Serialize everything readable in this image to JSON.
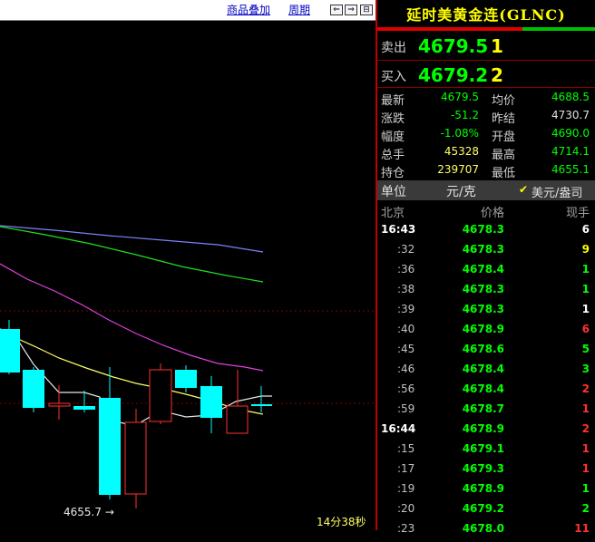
{
  "toolbar": {
    "overlay_label": "商品叠加",
    "period_label": "周期",
    "btn_prev": "⇐",
    "btn_next": "⇒",
    "btn_toggle": "⊟"
  },
  "chart": {
    "low_label": "4655.7",
    "timer": "14分38秒",
    "colors": {
      "up": "#ff3030",
      "down": "#00ffff",
      "ma_white": "#e8e8e8",
      "ma_yellow": "#ffff66",
      "ma_magenta": "#e040e0",
      "ma_green": "#20e020",
      "ma_blue": "#8080ff",
      "grid": "#800000"
    }
  },
  "quote": {
    "title": "延时美黄金连(GLNC)",
    "sell_label": "卖出",
    "sell_price": "4679.5",
    "sell_vol": "1",
    "buy_label": "买入",
    "buy_price": "4679.2",
    "buy_vol": "2",
    "stats": [
      {
        "k1": "最新",
        "v1": "4679.5",
        "c1": "#00ff00",
        "k2": "均价",
        "v2": "4688.5",
        "c2": "#00ff00"
      },
      {
        "k1": "涨跌",
        "v1": "-51.2",
        "c1": "#00ff00",
        "k2": "昨结",
        "v2": "4730.7",
        "c2": "#e0e0e0"
      },
      {
        "k1": "幅度",
        "v1": "-1.08%",
        "c1": "#00ff00",
        "k2": "开盘",
        "v2": "4690.0",
        "c2": "#00ff00"
      },
      {
        "k1": "总手",
        "v1": "45328",
        "c1": "#ffff66",
        "k2": "最高",
        "v2": "4714.1",
        "c2": "#00ff00"
      },
      {
        "k1": "持仓",
        "v1": "239707",
        "c1": "#ffff66",
        "k2": "最低",
        "v2": "4655.1",
        "c2": "#00ff00"
      }
    ],
    "unit_label": "单位",
    "unit_value": "元/克",
    "unit_alt": "美元/盎司",
    "unit_check": "✔",
    "tick_headers": {
      "time": "北京",
      "price": "价格",
      "vol": "现手"
    },
    "ticks": [
      {
        "t": "16:43",
        "p": "4678.3",
        "v": "6",
        "vc": "#ffffff",
        "major": true
      },
      {
        "t": ":32",
        "p": "4678.3",
        "v": "9",
        "vc": "#ffff00",
        "major": false
      },
      {
        "t": ":36",
        "p": "4678.4",
        "v": "1",
        "vc": "#00ff00",
        "major": false
      },
      {
        "t": ":38",
        "p": "4678.3",
        "v": "1",
        "vc": "#00ff00",
        "major": false
      },
      {
        "t": ":39",
        "p": "4678.3",
        "v": "1",
        "vc": "#ffffff",
        "major": false
      },
      {
        "t": ":40",
        "p": "4678.9",
        "v": "6",
        "vc": "#ff3030",
        "major": false
      },
      {
        "t": ":45",
        "p": "4678.6",
        "v": "5",
        "vc": "#00ff00",
        "major": false
      },
      {
        "t": ":46",
        "p": "4678.4",
        "v": "3",
        "vc": "#00ff00",
        "major": false
      },
      {
        "t": ":56",
        "p": "4678.4",
        "v": "2",
        "vc": "#ff3030",
        "major": false
      },
      {
        "t": ":59",
        "p": "4678.7",
        "v": "1",
        "vc": "#ff3030",
        "major": false
      },
      {
        "t": "16:44",
        "p": "4678.9",
        "v": "2",
        "vc": "#ff3030",
        "major": true
      },
      {
        "t": ":15",
        "p": "4679.1",
        "v": "1",
        "vc": "#ff3030",
        "major": false
      },
      {
        "t": ":17",
        "p": "4679.3",
        "v": "1",
        "vc": "#ff3030",
        "major": false
      },
      {
        "t": ":19",
        "p": "4678.9",
        "v": "1",
        "vc": "#00ff00",
        "major": false
      },
      {
        "t": ":20",
        "p": "4679.2",
        "v": "2",
        "vc": "#00ff00",
        "major": false
      },
      {
        "t": ":23",
        "p": "4678.0",
        "v": "11",
        "vc": "#ff3030",
        "major": false
      }
    ]
  }
}
